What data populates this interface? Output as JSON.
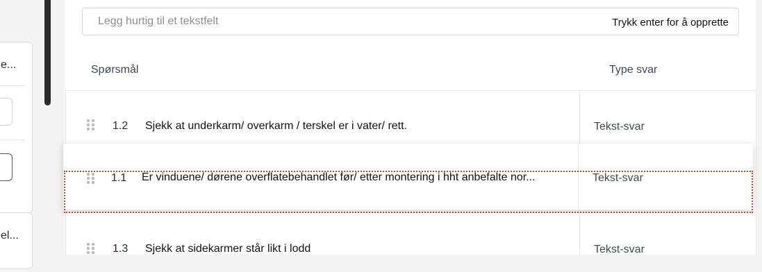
{
  "sidebar": {
    "item1_label": "e...",
    "item2_label": "el..."
  },
  "quick_add": {
    "placeholder": "Legg hurtig til et tekstfelt",
    "hint": "Trykk enter for å opprette"
  },
  "table": {
    "headers": {
      "question": "Spørsmål",
      "answer_type": "Type svar"
    },
    "rows": [
      {
        "number": "1.2",
        "question": "Sjekk at underkarm/ overkarm / terskel er i vater/ rett.",
        "answer_type": "Tekst-svar"
      },
      {
        "number": "1.3",
        "question": "Sjekk at sidekarmer står likt i lodd",
        "answer_type": "Tekst-svar"
      }
    ],
    "dragging_row": {
      "number": "1.1",
      "question": "Er vinduene/ dørene overflatebehandlet før/ etter montering i hht anbefalte nor...",
      "answer_type": "Tekst-svar"
    }
  },
  "colors": {
    "drop_indicator": "#d8461c",
    "scrollbar": "#2b2b2b"
  }
}
